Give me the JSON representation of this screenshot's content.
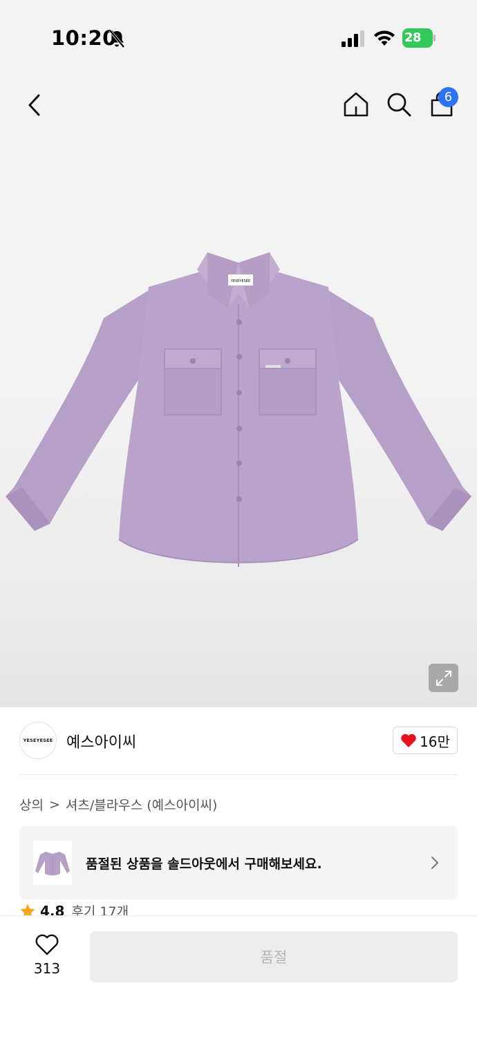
{
  "status_bar": {
    "time": "10:20",
    "battery": "28"
  },
  "nav": {
    "cart_count": "6"
  },
  "product": {
    "shirt_color": "#b7a0c8",
    "label_text": "YESEYESEE"
  },
  "brand": {
    "logo_text": "YESEYESEE",
    "name": "예스아이씨",
    "likes": "16만"
  },
  "breadcrumb": {
    "category": "상의",
    "separator": ">",
    "subcategory": "셔츠/블라우스 (예스아이씨)"
  },
  "soldout_banner": {
    "text": "품절된 상품을 솔드아웃에서 구매해보세요."
  },
  "rating": {
    "score": "4.8",
    "reviews": "후기 17개"
  },
  "bottom_bar": {
    "wish_count": "313",
    "action_label": "품절"
  },
  "colors": {
    "badge": "#2d73f5",
    "heart": "#e8121f",
    "star": "#f5a623",
    "battery": "#34c759"
  }
}
